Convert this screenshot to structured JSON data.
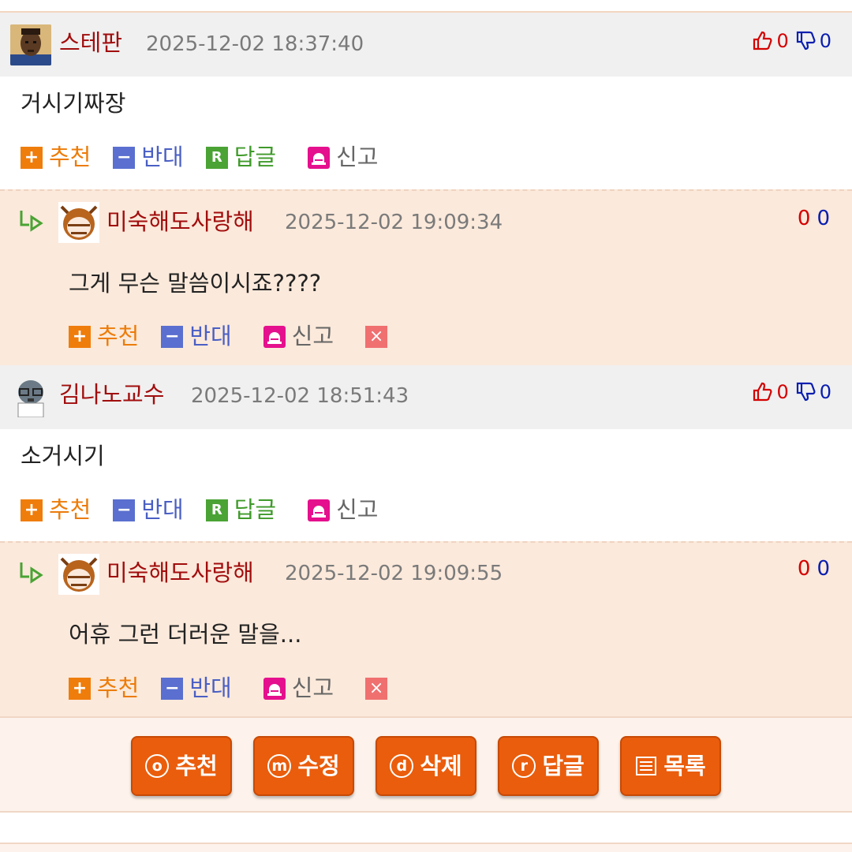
{
  "comments": [
    {
      "author": "스테판",
      "date": "2025-12-02 18:37:40",
      "up": "0",
      "down": "0",
      "text": "거시기짜장",
      "actions": {
        "recommend": "추천",
        "oppose": "반대",
        "reply": "답글",
        "report": "신고"
      },
      "reply": {
        "author": "미숙해도사랑해",
        "date": "2025-12-02 19:09:34",
        "up": "0",
        "down": "0",
        "text": "그게 무슨 말씀이시죠????",
        "actions": {
          "recommend": "추천",
          "oppose": "반대",
          "report": "신고"
        }
      }
    },
    {
      "author": "김나노교수",
      "date": "2025-12-02 18:51:43",
      "up": "0",
      "down": "0",
      "text": "소거시기",
      "actions": {
        "recommend": "추천",
        "oppose": "반대",
        "reply": "답글",
        "report": "신고"
      },
      "reply": {
        "author": "미숙해도사랑해",
        "date": "2025-12-02 19:09:55",
        "up": "0",
        "down": "0",
        "text": "어휴 그런 더러운 말을...",
        "actions": {
          "recommend": "추천",
          "oppose": "반대",
          "report": "신고"
        }
      }
    }
  ],
  "bottom_buttons": [
    {
      "key": "o",
      "label": "추천"
    },
    {
      "key": "m",
      "label": "수정"
    },
    {
      "key": "d",
      "label": "삭제"
    },
    {
      "key": "r",
      "label": "답글"
    },
    {
      "key": "list",
      "label": "목록"
    }
  ],
  "colors": {
    "author": "#a10d0d",
    "recommend": "#ef7d0b",
    "oppose": "#5a6fcf",
    "reply": "#4aa334",
    "report": "#e5108d",
    "button": "#ea5d0c",
    "reply_bg": "#fbe9db",
    "header_bg": "#f0f0f0"
  },
  "icons": {
    "thumbs_up": "thumbs-up-icon",
    "thumbs_down": "thumbs-down-icon",
    "reply_arrow": "reply-arrow-icon",
    "report": "siren-icon",
    "delete": "close-icon",
    "list": "list-icon"
  }
}
